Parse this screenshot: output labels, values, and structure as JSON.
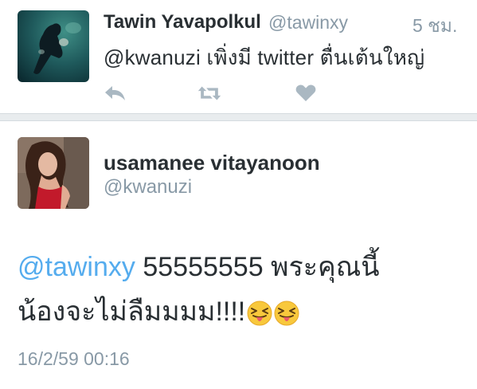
{
  "retweet": {
    "name": "Tawin Yavapolkul",
    "handle": "@tawinxy",
    "time": "5 ชม.",
    "text": "@kwanuzi เพิ่งมี twitter ตื่นเต้นใหญ่",
    "actions": {
      "reply_icon": "reply-icon",
      "retweet_icon": "retweet-icon",
      "like_icon": "heart-icon"
    }
  },
  "tweet": {
    "name": "usamanee vitayanoon",
    "handle": "@kwanuzi",
    "mention": "@tawinxy",
    "text_line1": " 55555555 พระคุณนี้",
    "text_line2": "น้องจะไม่ลืมมมม!!!!",
    "emoji": [
      "squinting-face-with-tongue",
      "squinting-face-with-tongue"
    ],
    "date": "16/2/59 00:16"
  },
  "colors": {
    "text": "#292f33",
    "muted": "#8899a6",
    "link": "#55acee",
    "icon": "#aab8c2",
    "divider": "#e8ecee"
  }
}
